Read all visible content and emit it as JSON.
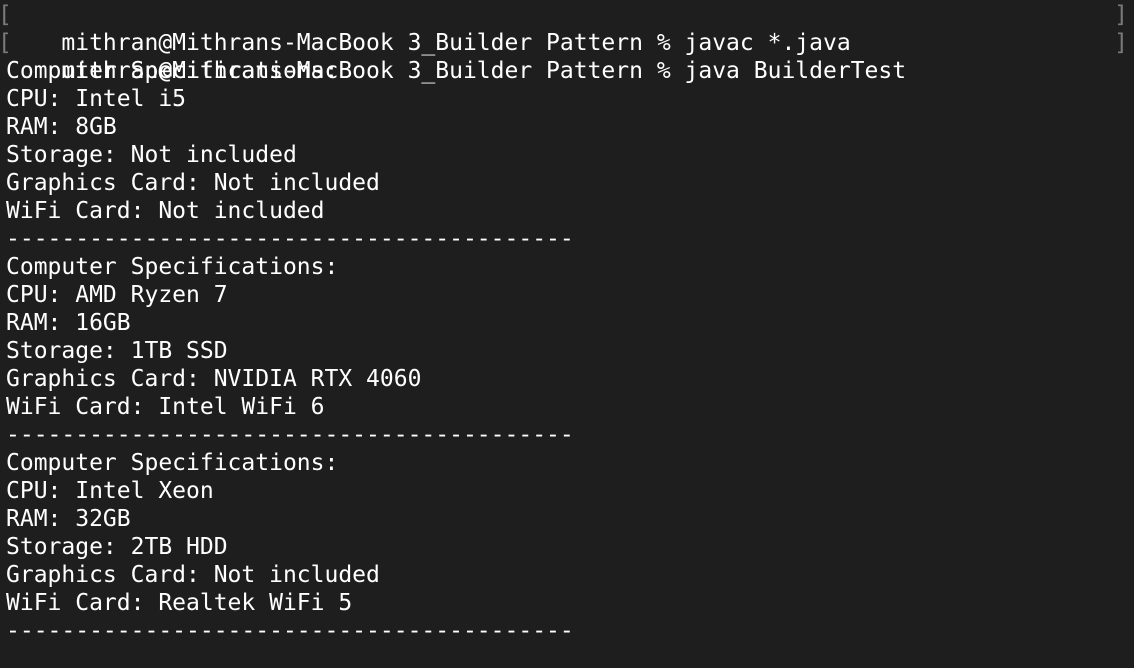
{
  "terminal": {
    "prompt": "mithran@Mithrans-MacBook 3_Builder Pattern % ",
    "commands": [
      {
        "text": "javac *.java"
      },
      {
        "text": "java BuilderTest"
      }
    ],
    "bracket_left": "[",
    "bracket_right": "]",
    "output": [
      "Computer Specifications:",
      "CPU: Intel i5",
      "RAM: 8GB",
      "Storage: Not included",
      "Graphics Card: Not included",
      "WiFi Card: Not included",
      "-----------------------------------------",
      "Computer Specifications:",
      "CPU: AMD Ryzen 7",
      "RAM: 16GB",
      "Storage: 1TB SSD",
      "Graphics Card: NVIDIA RTX 4060",
      "WiFi Card: Intel WiFi 6",
      "-----------------------------------------",
      "Computer Specifications:",
      "CPU: Intel Xeon",
      "RAM: 32GB",
      "Storage: 2TB HDD",
      "Graphics Card: Not included",
      "WiFi Card: Realtek WiFi 5",
      "-----------------------------------------"
    ],
    "colors": {
      "background": "#1e1e1e",
      "text": "#ffffff",
      "cursor": "#bfbfbf",
      "bracket": "#7a7a7a"
    }
  }
}
